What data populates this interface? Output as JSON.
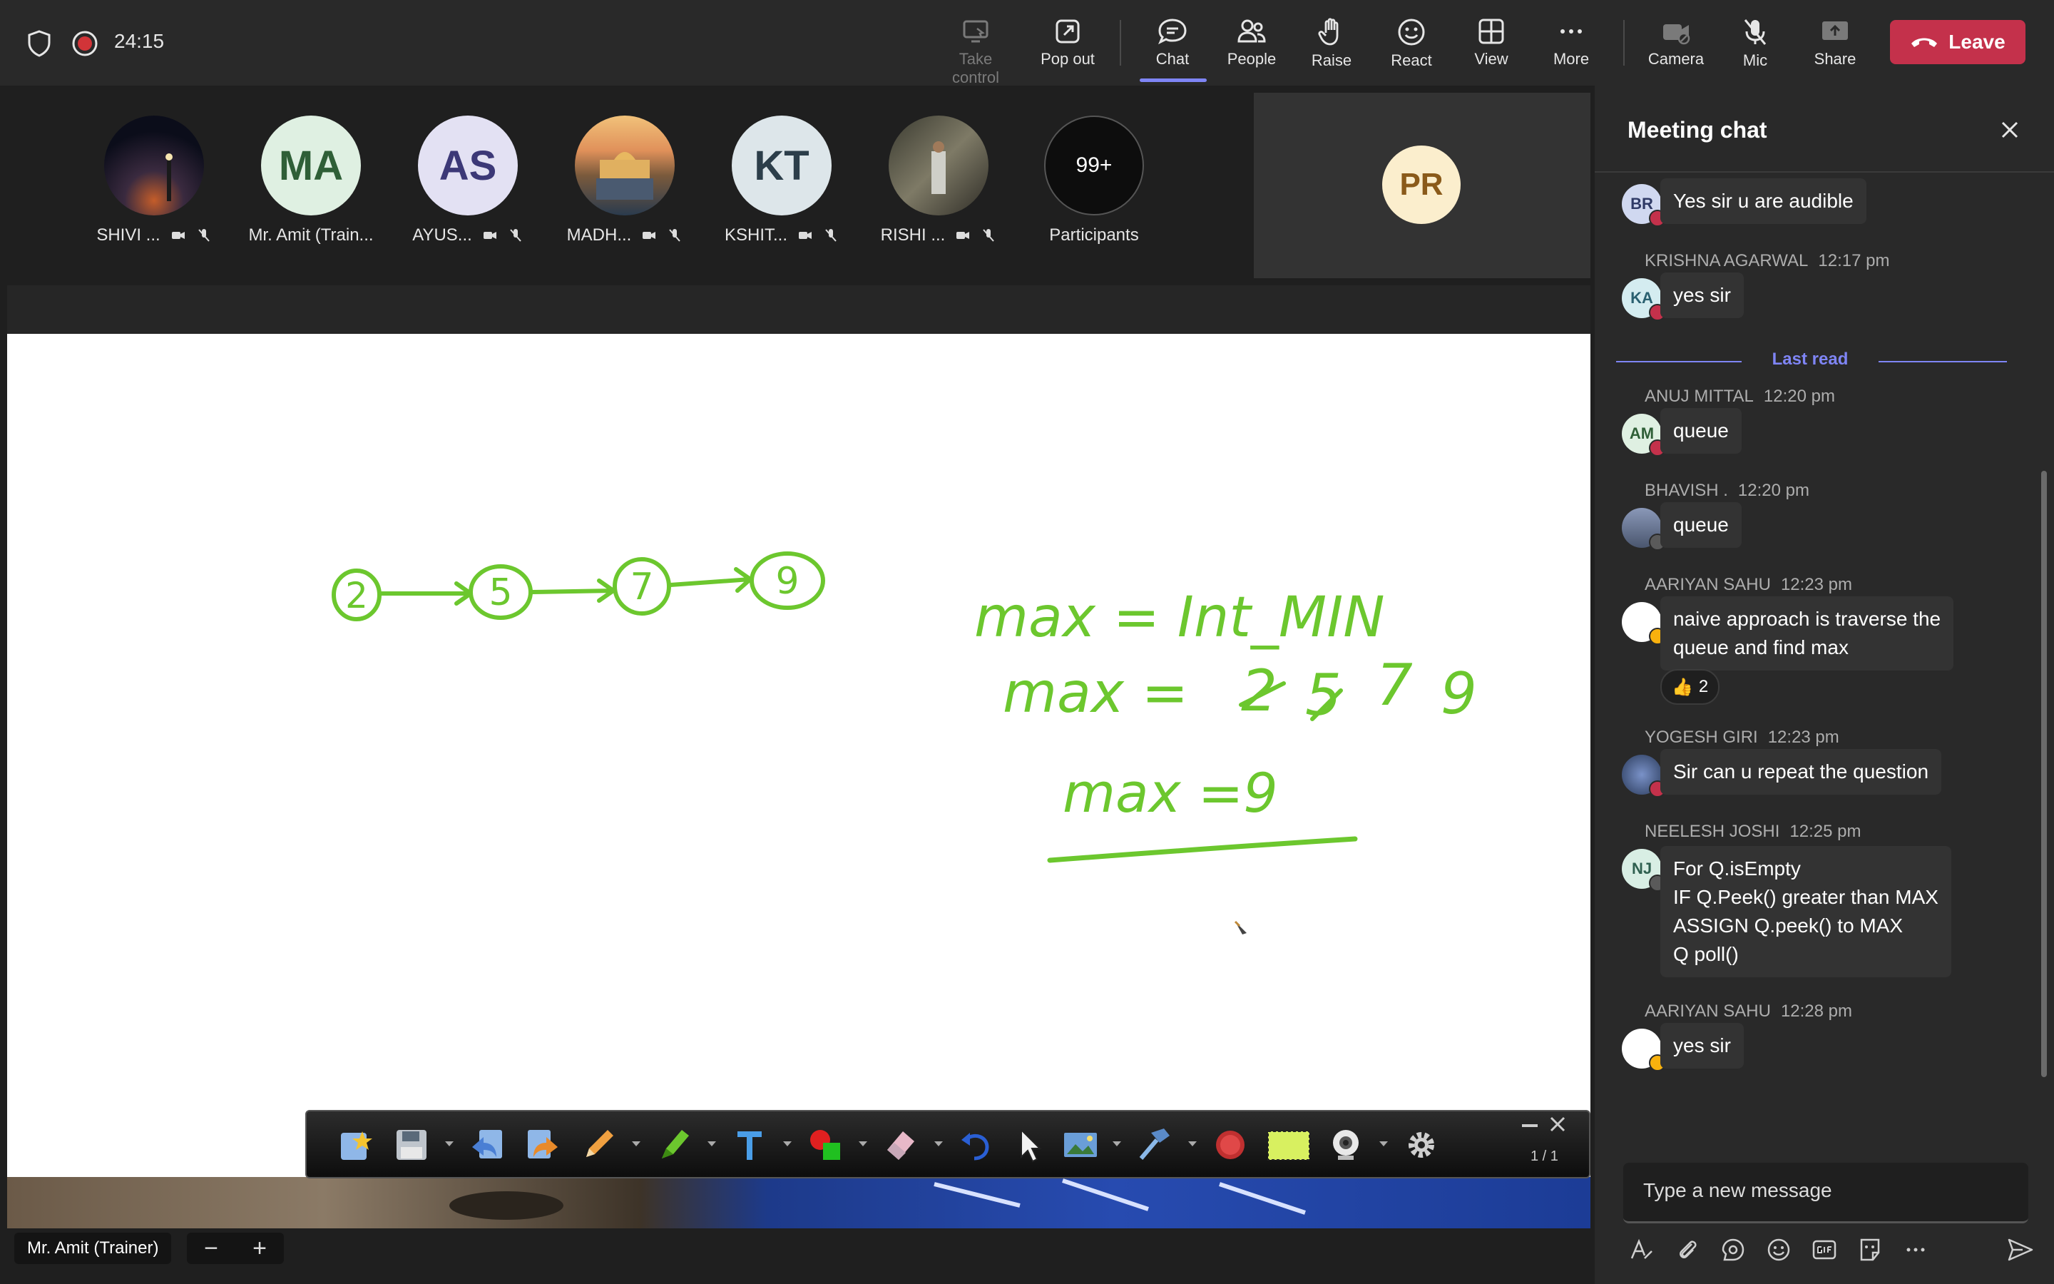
{
  "call": {
    "timer": "24:15"
  },
  "toolbar": {
    "take_control": "Take control",
    "pop_out": "Pop out",
    "chat": "Chat",
    "people": "People",
    "raise": "Raise",
    "react": "React",
    "view": "View",
    "more": "More",
    "camera": "Camera",
    "mic": "Mic",
    "share": "Share",
    "leave": "Leave"
  },
  "gallery": {
    "participants": [
      {
        "name": "SHIVI ...",
        "initials": "",
        "color": "#0b0d1a"
      },
      {
        "name": "Mr. Amit (Train...",
        "initials": "MA",
        "color": "#dff0e2"
      },
      {
        "name": "AYUS...",
        "initials": "AS",
        "color": "#e3e1f3"
      },
      {
        "name": "MADH...",
        "initials": "",
        "color": "#6b5744"
      },
      {
        "name": "KSHIT...",
        "initials": "KT",
        "color": "#dde6ea"
      },
      {
        "name": "RISHI ...",
        "initials": "",
        "color": "#5d5a4e"
      }
    ],
    "overflow_count": "99+",
    "overflow_label": "Participants",
    "self_initials": "PR"
  },
  "whiteboard": {
    "nodes": [
      "2",
      "5",
      "7",
      "9"
    ],
    "line1": "max = Int_MIN",
    "line2_prefix": "max =",
    "line2_values": [
      "2",
      "5",
      "7",
      "9"
    ],
    "line3": "max =9",
    "page": "1 / 1"
  },
  "presenter": {
    "name": "Mr. Amit (Trainer)"
  },
  "chat": {
    "title": "Meeting chat",
    "last_read": "Last read",
    "messages": [
      {
        "sender": "",
        "time": "",
        "initials": "BR",
        "text": "Yes sir u are audible"
      },
      {
        "sender": "KRISHNA AGARWAL",
        "time": "12:17 pm",
        "initials": "KA",
        "text": "yes sir"
      },
      {
        "sender": "ANUJ MITTAL",
        "time": "12:20 pm",
        "initials": "AM",
        "text": "queue"
      },
      {
        "sender": "BHAVISH .",
        "time": "12:20 pm",
        "initials": "",
        "text": "queue"
      },
      {
        "sender": "AARIYAN SAHU",
        "time": "12:23 pm",
        "initials": "",
        "text_lines": [
          "naive approach is traverse the",
          "queue and find max"
        ],
        "reaction_count": "2"
      },
      {
        "sender": "YOGESH GIRI",
        "time": "12:23 pm",
        "initials": "",
        "text": "Sir can u repeat the question"
      },
      {
        "sender": "NEELESH JOSHI",
        "time": "12:25 pm",
        "initials": "NJ",
        "text_lines": [
          "For Q.isEmpty",
          "IF Q.Peek() greater than MAX",
          "ASSIGN Q.peek() to MAX",
          "Q poll()"
        ]
      },
      {
        "sender": "AARIYAN SAHU",
        "time": "12:28 pm",
        "initials": "",
        "text": "yes sir"
      }
    ],
    "compose_placeholder": "Type a new message"
  },
  "colors": {
    "accent": "#7f85f5",
    "leave": "#c4314b",
    "ink": "#6cc72e"
  }
}
